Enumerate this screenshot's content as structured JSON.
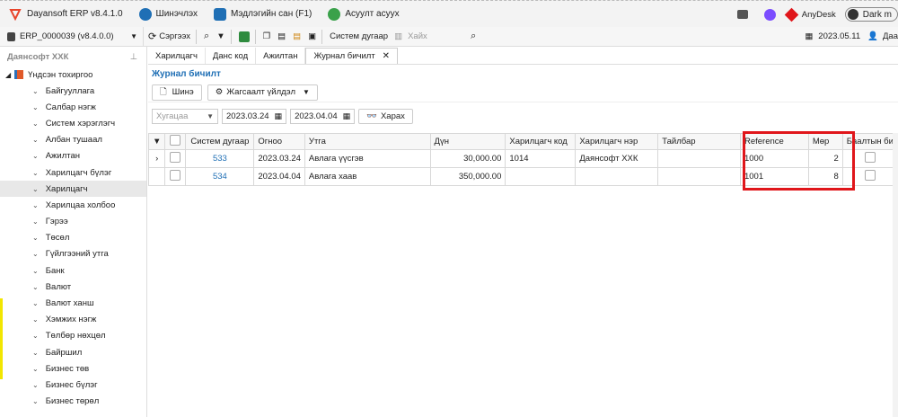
{
  "titlebar": {
    "app_title": "Dayansoft ERP v8.4.1.0",
    "menu": [
      {
        "label": "Шинэчлэх",
        "icon": "gear-icon"
      },
      {
        "label": "Мэдлэгийн сан (F1)",
        "icon": "help-book-icon"
      },
      {
        "label": "Асуулт асуух",
        "icon": "question-icon"
      }
    ],
    "anydesk_label": "AnyDesk",
    "dark_mode_label": "Dark m"
  },
  "toolbar": {
    "db_name": "ERP_0000039 (v8.4.0.0)",
    "refresh_label": "Сэргээх",
    "system_number_label": "Систем дугаар",
    "search_placeholder": "Хайх",
    "date": "2023.05.11",
    "user_label": "Даа"
  },
  "sidebar": {
    "company": "Даянсофт ХХК",
    "root": "Үндсэн тохиргоо",
    "items": [
      "Байгууллага",
      "Салбар нэгж",
      "Систем хэрэглэгч",
      "Албан тушаал",
      "Ажилтан",
      "Харилцагч бүлэг",
      "Харилцагч",
      "Харилцаа холбоо",
      "Гэрээ",
      "Төсөл",
      "Гүйлгээний утга",
      "Банк",
      "Валют",
      "Валют ханш",
      "Хэмжих нэгж",
      "Төлбөр нөхцөл",
      "Байршил",
      "Бизнес төв",
      "Бизнес бүлэг",
      "Бизнес төрөл"
    ],
    "selected_index": 6
  },
  "tabs": [
    "Харилцагч",
    "Данс код",
    "Ажилтан",
    "Журнал бичилт"
  ],
  "page": {
    "title": "Журнал бичилт",
    "new_button": "Шинэ",
    "action_button": "Жагсаалт үйлдэл",
    "period_placeholder": "Хугацаа",
    "date_from": "2023.03.24",
    "date_to": "2023.04.04",
    "search_button": "Харах"
  },
  "grid": {
    "columns": [
      "Систем дугаар",
      "Огноо",
      "Утга",
      "Дүн",
      "Харилцагч код",
      "Харилцагч нэр",
      "Тайлбар",
      "Reference",
      "Мөр",
      "Баалтын би"
    ],
    "rows": [
      {
        "sys": "533",
        "date": "2023.03.24",
        "desc": "Авлага үүсгэв",
        "amount": "30,000.00",
        "partner_code": "1014",
        "partner_name": "Даянсофт ХХК",
        "note": "",
        "reference": "1000",
        "line": "2"
      },
      {
        "sys": "534",
        "date": "2023.04.04",
        "desc": "Авлага хаав",
        "amount": "350,000.00",
        "partner_code": "",
        "partner_name": "",
        "note": "",
        "reference": "1001",
        "line": "8"
      }
    ]
  },
  "colors": {
    "accent": "#1f6fb5",
    "highlight": "#e0161b"
  }
}
